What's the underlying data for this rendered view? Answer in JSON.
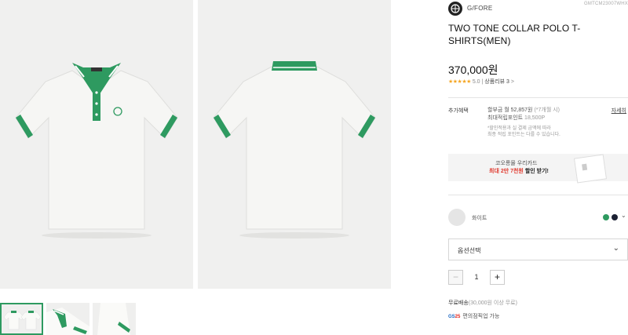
{
  "gallery": {
    "colors": {
      "collar": "#2e9a60",
      "shirt": "#f4f4f2",
      "tip": "#ffffff"
    }
  },
  "product": {
    "brand": "G/FORE",
    "sku": "GMTCM23007WHX",
    "title": "TWO TONE COLLAR POLO T-SHIRTS(MEN)",
    "price": "370,000원",
    "rating_score": "5.0",
    "review_label": "상품리뷰 3",
    "stars": "★★★★★"
  },
  "benefits": {
    "label": "추가혜택",
    "detail_link": "자세히",
    "line1": "할부금 월 52,857원",
    "line1_note": "(*7개월 시)",
    "line2": "최대적립포인트",
    "line2_value": "18,500P",
    "note1": "*할인적용과 실 결제 금액에 따라",
    "note2": "최종 적립 포인트는 다를 수 있습니다."
  },
  "banner": {
    "line1": "코오롱몰 우리카드",
    "line2_prefix": "최대 2만 7천원",
    "line2_suffix": " 할인 받기!"
  },
  "color": {
    "selected": "화이트",
    "chevron": "⌄",
    "options": [
      "#2e9a60",
      "#1c2233"
    ]
  },
  "option_select": {
    "label": "옵션선택",
    "chevron": "⌄"
  },
  "quantity": {
    "minus": "−",
    "value": "1",
    "plus": "+"
  },
  "shipping": {
    "free": "무료배송",
    "condition": "(30,000원 이상 무료)",
    "gs_text": "GS",
    "gs_num": "25",
    "pickup": "편의점픽업 가능"
  }
}
